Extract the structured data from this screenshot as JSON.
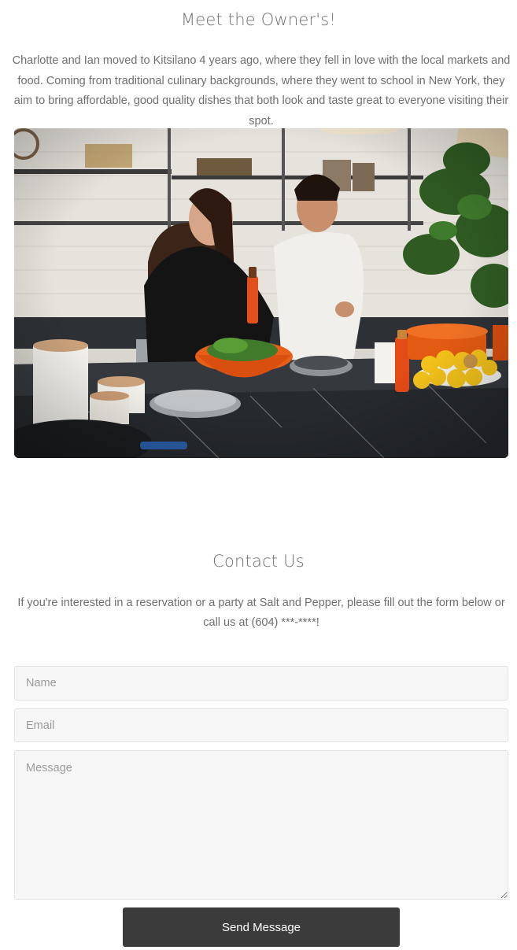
{
  "owners": {
    "title": "Meet the Owner's!",
    "description": "Charlotte and Ian moved to Kitsilano 4 years ago, where they fell in love with the local markets and food. Coming from traditional culinary backgrounds, where they went to school in New York, they aim to bring affordable, good quality dishes that both look and taste great to everyone visiting their spot."
  },
  "contact": {
    "title": "Contact Us",
    "description": "If you're interested in a reservation or a party at Salt and Pepper, please fill out the form below or call us at (604) ***-****!",
    "form": {
      "name_placeholder": "Name",
      "email_placeholder": "Email",
      "message_placeholder": "Message",
      "submit_label": "Send Message"
    }
  },
  "colors": {
    "button_background": "#3b3b3b",
    "field_background": "#f7f7f7",
    "text": "#6f6f6f"
  }
}
